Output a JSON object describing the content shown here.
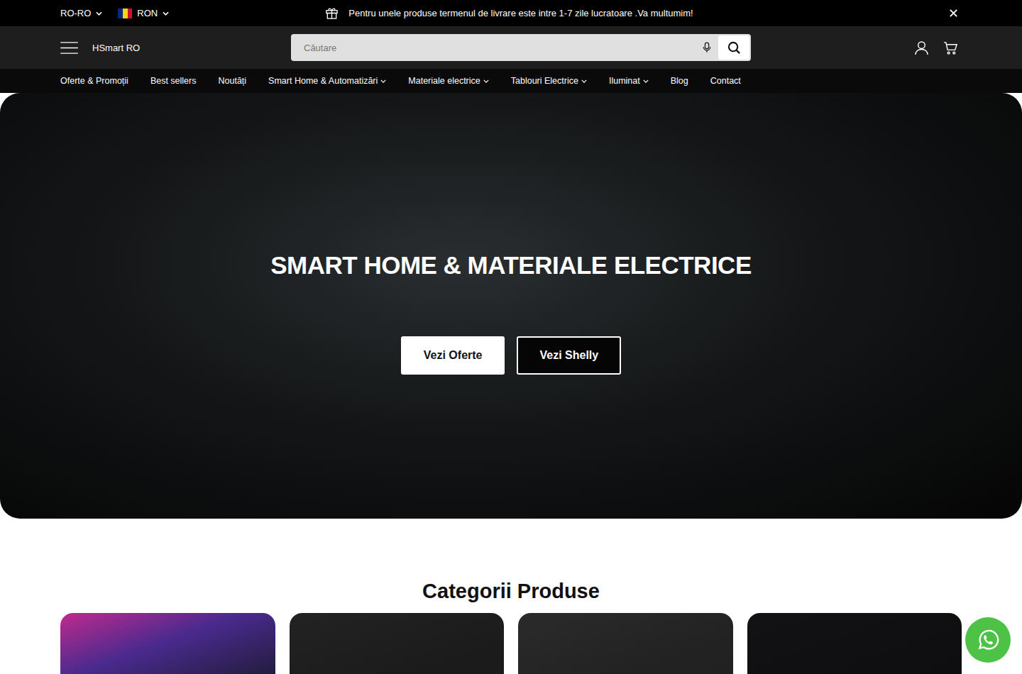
{
  "top_bar": {
    "locale": "RO-RO",
    "currency": "RON",
    "announcement": "Pentru unele produse termenul de livrare este intre 1-7 zile lucratoare .Va multumim!"
  },
  "header": {
    "brand": "HSmart RO",
    "search": {
      "placeholder": "Căutare"
    }
  },
  "nav": [
    {
      "label": "Oferte & Promoții",
      "dropdown": false
    },
    {
      "label": "Best sellers",
      "dropdown": false
    },
    {
      "label": "Noutăți",
      "dropdown": false
    },
    {
      "label": "Smart Home & Automatizări",
      "dropdown": true
    },
    {
      "label": "Materiale electrice",
      "dropdown": true
    },
    {
      "label": "Tablouri Electrice",
      "dropdown": true
    },
    {
      "label": "Iluminat",
      "dropdown": true
    },
    {
      "label": "Blog",
      "dropdown": false
    },
    {
      "label": "Contact",
      "dropdown": false
    }
  ],
  "hero": {
    "title": "SMART HOME & MATERIALE ELECTRICE",
    "buttons": [
      {
        "label": "Vezi Oferte",
        "kind": "light"
      },
      {
        "label": "Vezi Shelly",
        "kind": "dark"
      }
    ]
  },
  "categories": {
    "title": "Categorii Produse",
    "cards": [
      {},
      {},
      {},
      {}
    ]
  }
}
